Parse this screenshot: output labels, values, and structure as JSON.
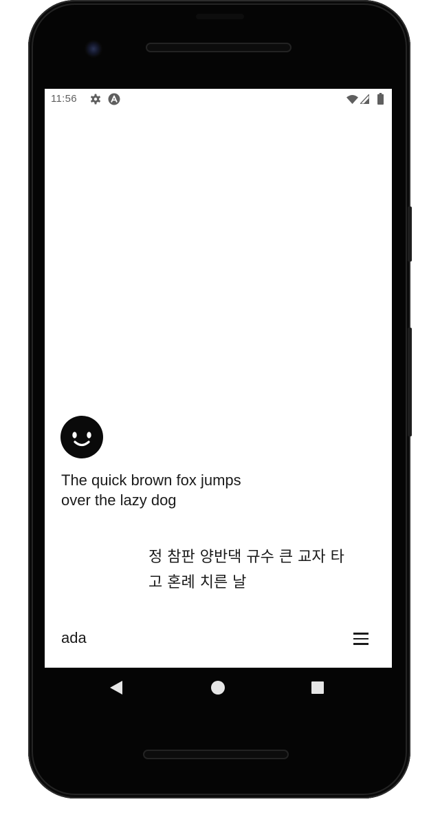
{
  "status_bar": {
    "time": "11:56",
    "icons": [
      "gear-icon",
      "android-a-icon",
      "wifi-icon",
      "cell-signal-icon",
      "battery-icon"
    ]
  },
  "content": {
    "avatar_icon": "smiley-face-icon",
    "english_line1": "The quick brown fox jumps",
    "english_line2": "over the lazy dog",
    "korean_line1": "정 참판 양반댁 규수 큰 교자 타",
    "korean_line2": "고 혼례 치른 날"
  },
  "bottom_bar": {
    "label": "ada",
    "menu_icon": "hamburger-menu-icon"
  },
  "nav_bar": {
    "buttons": [
      "back-icon",
      "home-icon",
      "recents-icon"
    ]
  },
  "colors": {
    "screen_background": "#ffffff",
    "text": "#1a1a1a",
    "phone_body": "#050505",
    "status_text": "#5f5f5f",
    "nav_icons": "#e6e6e6"
  }
}
